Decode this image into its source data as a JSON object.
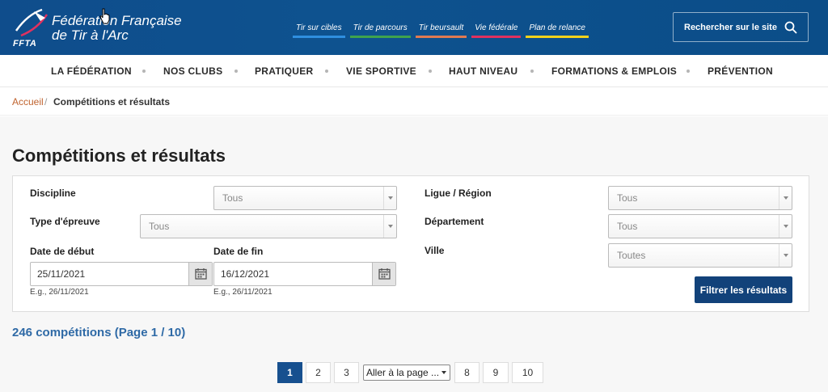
{
  "header": {
    "brand_line1": "Fédération Française",
    "brand_line2": "de Tir à l'Arc",
    "logo_text": "FFTA",
    "quicklinks": [
      {
        "label": "Tir sur cibles",
        "color": "#2f8fe0"
      },
      {
        "label": "Tir de parcours",
        "color": "#3fa34d"
      },
      {
        "label": "Tir beursault",
        "color": "#e07a52"
      },
      {
        "label": "Vie fédérale",
        "color": "#e0315f"
      },
      {
        "label": "Plan de relance",
        "color": "#f2d21b"
      }
    ],
    "search_label": "Rechercher sur le site",
    "search_icon": "search-icon"
  },
  "nav": {
    "items": [
      {
        "label": "LA FÉDÉRATION"
      },
      {
        "label": "NOS CLUBS"
      },
      {
        "label": "PRATIQUER"
      },
      {
        "label": "VIE SPORTIVE"
      },
      {
        "label": "HAUT NIVEAU"
      },
      {
        "label": "FORMATIONS & EMPLOIS"
      },
      {
        "label": "PRÉVENTION"
      }
    ]
  },
  "breadcrumb": {
    "home": "Accueil",
    "separator": "/",
    "current": "Compétitions et résultats"
  },
  "page": {
    "title": "Compétitions et résultats"
  },
  "filters": {
    "discipline": {
      "label": "Discipline",
      "value": "Tous"
    },
    "type_epreuve": {
      "label": "Type d'épreuve",
      "value": "Tous"
    },
    "date_debut": {
      "label": "Date de début",
      "value": "25/11/2021",
      "hint": "E.g., 26/11/2021"
    },
    "date_fin": {
      "label": "Date de fin",
      "value": "16/12/2021",
      "hint": "E.g., 26/11/2021"
    },
    "ligue": {
      "label": "Ligue / Région",
      "value": "Tous"
    },
    "departement": {
      "label": "Département",
      "value": "Tous"
    },
    "ville": {
      "label": "Ville",
      "value": "Toutes"
    },
    "submit_label": "Filtrer les résultats"
  },
  "results": {
    "count_text": "246 compétitions (Page 1 / 10)"
  },
  "pagination": {
    "pages_before": [
      "1",
      "2",
      "3"
    ],
    "jump_label": "Aller à la page ...",
    "pages_after": [
      "8",
      "9",
      "10"
    ],
    "active_page": "1"
  },
  "colors": {
    "header_bg": "#0f4d8c",
    "accent": "#12427a",
    "link": "#2f6aa6",
    "breadcrumb_home": "#c0632e"
  }
}
